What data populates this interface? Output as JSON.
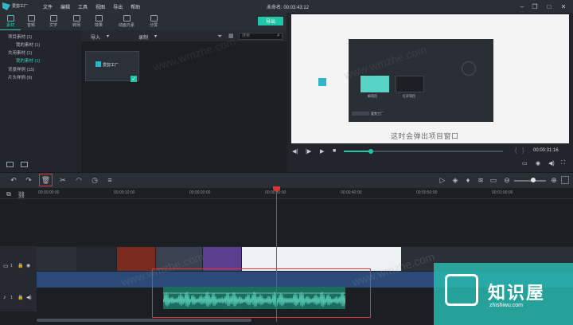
{
  "app": {
    "logo_text": "爱剪工厂",
    "window_title": "未命名: 00:03:43:12",
    "menu": [
      "文件",
      "编辑",
      "工具",
      "视图",
      "导出",
      "帮助"
    ],
    "window_controls": [
      "minimize",
      "restore",
      "maximize",
      "close"
    ]
  },
  "toolbar": {
    "tabs": [
      {
        "label": "素材",
        "icon": "folder-icon",
        "active": true
      },
      {
        "label": "音频",
        "icon": "music-note-icon",
        "active": false
      },
      {
        "label": "文字",
        "icon": "text-icon",
        "active": false
      },
      {
        "label": "转场",
        "icon": "transition-icon",
        "active": false
      },
      {
        "label": "效果",
        "icon": "effects-icon",
        "active": false
      },
      {
        "label": "动画元素",
        "icon": "image-icon",
        "active": false
      },
      {
        "label": "分屏",
        "icon": "split-screen-icon",
        "active": false
      }
    ],
    "export_label": "导出"
  },
  "sidebar": {
    "items": [
      {
        "label": "项目素材 (1)",
        "indent": false,
        "active": false
      },
      {
        "label": "我的素材 (1)",
        "indent": true,
        "active": false
      },
      {
        "label": "共用素材 (1)",
        "indent": false,
        "active": false
      },
      {
        "label": "我的素材 (1)",
        "indent": true,
        "active": true
      },
      {
        "label": "背景样例 (15)",
        "indent": false,
        "active": false
      },
      {
        "label": "片头样例 (9)",
        "indent": false,
        "active": false
      }
    ]
  },
  "library": {
    "import_label": "导入",
    "record_label": "录制",
    "search_placeholder": "搜索",
    "thumb_logo": "爱剪工厂"
  },
  "preview": {
    "caption": "这时会弹出项目窗口",
    "timecode": "00:00:31:16",
    "progress": 0.17,
    "dialog": {
      "logo_text": "爱剪工厂",
      "btn_new": "新项目",
      "btn_open": "打开项目"
    }
  },
  "timeline": {
    "ruler": [
      "00:00:00:00",
      "00:00:10:00",
      "00:00:20:00",
      "00:00:30:00",
      "00:00:40:00",
      "00:00:50:00",
      "00:01:00:00"
    ],
    "video_track_num": "1",
    "audio_track_num": "1"
  },
  "watermarks": {
    "url": "www.wmzhe.com",
    "brand": "知识屋",
    "brand_url": "zhishiwu.com"
  }
}
